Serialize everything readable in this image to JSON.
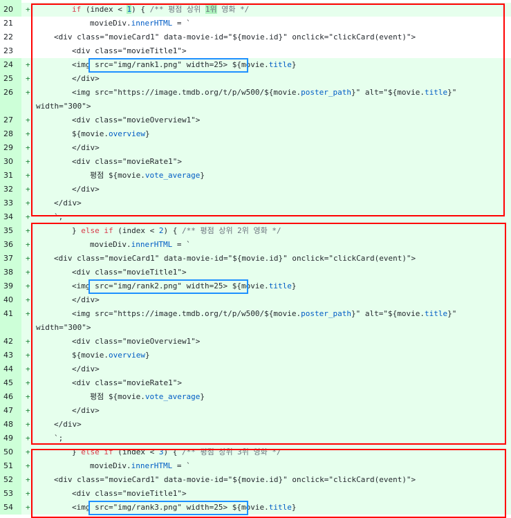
{
  "diff": {
    "lines": [
      {
        "n": "20",
        "k": "add",
        "i": 2,
        "s": [
          [
            "kw",
            "if"
          ],
          [
            "t",
            " (index < "
          ],
          [
            "hl",
            "1"
          ],
          [
            "t",
            ") { "
          ],
          [
            "cm",
            "/** 평점 상위 "
          ],
          [
            "hlcm",
            "1위"
          ],
          [
            "cm",
            " 영화 */"
          ]
        ]
      },
      {
        "n": "21",
        "k": "ctx",
        "i": 3,
        "s": [
          [
            "t",
            "movieDiv."
          ],
          [
            "prop",
            "innerHTML"
          ],
          [
            "t",
            " = `"
          ]
        ]
      },
      {
        "n": "22",
        "k": "ctx",
        "i": 1,
        "s": [
          [
            "t",
            "<div class=\"movieCard1\" data-movie-id=\"${movie.id}\" onclick=\"clickCard(event)\">"
          ]
        ]
      },
      {
        "n": "23",
        "k": "ctx",
        "i": 2,
        "s": [
          [
            "t",
            "<div class=\"movieTitle1\">"
          ]
        ]
      },
      {
        "n": "24",
        "k": "add",
        "i": 2,
        "s": [
          [
            "t",
            "<img src=\"img/rank1.png\" width=25>"
          ],
          [
            "t",
            " ${movie."
          ],
          [
            "prop",
            "title"
          ],
          [
            "t",
            "}"
          ]
        ]
      },
      {
        "n": "25",
        "k": "add",
        "i": 2,
        "s": [
          [
            "t",
            "</div>"
          ]
        ]
      },
      {
        "n": "26",
        "k": "add",
        "i": 2,
        "s": [
          [
            "t",
            "<img src=\"https://image.tmdb.org/t/p/w500/${movie."
          ],
          [
            "prop",
            "poster_path"
          ],
          [
            "t",
            "}\" alt=\"${movie."
          ],
          [
            "prop",
            "title"
          ],
          [
            "t",
            "}\""
          ]
        ]
      },
      {
        "n": "",
        "k": "add",
        "i": -1,
        "s": [
          [
            "t",
            "width=\"300\">"
          ]
        ]
      },
      {
        "n": "27",
        "k": "add",
        "i": 2,
        "s": [
          [
            "t",
            "<div class=\"movieOverview1\">"
          ]
        ]
      },
      {
        "n": "28",
        "k": "add",
        "i": 2,
        "s": [
          [
            "t",
            "${movie."
          ],
          [
            "prop",
            "overview"
          ],
          [
            "t",
            "}"
          ]
        ]
      },
      {
        "n": "29",
        "k": "add",
        "i": 2,
        "s": [
          [
            "t",
            "</div>"
          ]
        ]
      },
      {
        "n": "30",
        "k": "add",
        "i": 2,
        "s": [
          [
            "t",
            "<div class=\"movieRate1\">"
          ]
        ]
      },
      {
        "n": "31",
        "k": "add",
        "i": 3,
        "s": [
          [
            "t",
            "평점 ${movie."
          ],
          [
            "prop",
            "vote_average"
          ],
          [
            "t",
            "}"
          ]
        ]
      },
      {
        "n": "32",
        "k": "add",
        "i": 2,
        "s": [
          [
            "t",
            "</div>"
          ]
        ]
      },
      {
        "n": "33",
        "k": "add",
        "i": 1,
        "s": [
          [
            "t",
            "</div>"
          ]
        ]
      },
      {
        "n": "34",
        "k": "add",
        "i": 1,
        "s": [
          [
            "t",
            "`;"
          ]
        ]
      },
      {
        "n": "35",
        "k": "add",
        "i": 2,
        "s": [
          [
            "t",
            "} "
          ],
          [
            "kw",
            "else if"
          ],
          [
            "t",
            " (index < "
          ],
          [
            "num-lit",
            "2"
          ],
          [
            "t",
            ") { "
          ],
          [
            "cm",
            "/** 평점 상위 2위 영화 */"
          ]
        ]
      },
      {
        "n": "36",
        "k": "add",
        "i": 3,
        "s": [
          [
            "t",
            "movieDiv."
          ],
          [
            "prop",
            "innerHTML"
          ],
          [
            "t",
            " = `"
          ]
        ]
      },
      {
        "n": "37",
        "k": "add",
        "i": 1,
        "s": [
          [
            "t",
            "<div class=\"movieCard1\" data-movie-id=\"${movie.id}\" onclick=\"clickCard(event)\">"
          ]
        ]
      },
      {
        "n": "38",
        "k": "add",
        "i": 2,
        "s": [
          [
            "t",
            "<div class=\"movieTitle1\">"
          ]
        ]
      },
      {
        "n": "39",
        "k": "add",
        "i": 2,
        "s": [
          [
            "t",
            "<img src=\"img/rank2.png\" width=25>"
          ],
          [
            "t",
            " ${movie."
          ],
          [
            "prop",
            "title"
          ],
          [
            "t",
            "}"
          ]
        ]
      },
      {
        "n": "40",
        "k": "add",
        "i": 2,
        "s": [
          [
            "t",
            "</div>"
          ]
        ]
      },
      {
        "n": "41",
        "k": "add",
        "i": 2,
        "s": [
          [
            "t",
            "<img src=\"https://image.tmdb.org/t/p/w500/${movie."
          ],
          [
            "prop",
            "poster_path"
          ],
          [
            "t",
            "}\" alt=\"${movie."
          ],
          [
            "prop",
            "title"
          ],
          [
            "t",
            "}\""
          ]
        ]
      },
      {
        "n": "",
        "k": "add",
        "i": -1,
        "s": [
          [
            "t",
            "width=\"300\">"
          ]
        ]
      },
      {
        "n": "42",
        "k": "add",
        "i": 2,
        "s": [
          [
            "t",
            "<div class=\"movieOverview1\">"
          ]
        ]
      },
      {
        "n": "43",
        "k": "add",
        "i": 2,
        "s": [
          [
            "t",
            "${movie."
          ],
          [
            "prop",
            "overview"
          ],
          [
            "t",
            "}"
          ]
        ]
      },
      {
        "n": "44",
        "k": "add",
        "i": 2,
        "s": [
          [
            "t",
            "</div>"
          ]
        ]
      },
      {
        "n": "45",
        "k": "add",
        "i": 2,
        "s": [
          [
            "t",
            "<div class=\"movieRate1\">"
          ]
        ]
      },
      {
        "n": "46",
        "k": "add",
        "i": 3,
        "s": [
          [
            "t",
            "평점 ${movie."
          ],
          [
            "prop",
            "vote_average"
          ],
          [
            "t",
            "}"
          ]
        ]
      },
      {
        "n": "47",
        "k": "add",
        "i": 2,
        "s": [
          [
            "t",
            "</div>"
          ]
        ]
      },
      {
        "n": "48",
        "k": "add",
        "i": 1,
        "s": [
          [
            "t",
            "</div>"
          ]
        ]
      },
      {
        "n": "49",
        "k": "add",
        "i": 1,
        "s": [
          [
            "t",
            "`;"
          ]
        ]
      },
      {
        "n": "50",
        "k": "add",
        "i": 2,
        "s": [
          [
            "t",
            "} "
          ],
          [
            "kw",
            "else if"
          ],
          [
            "t",
            " (index < "
          ],
          [
            "num-lit",
            "3"
          ],
          [
            "t",
            ") { "
          ],
          [
            "cm",
            "/** 평점 상위 3위 영화 */"
          ]
        ]
      },
      {
        "n": "51",
        "k": "add",
        "i": 3,
        "s": [
          [
            "t",
            "movieDiv."
          ],
          [
            "prop",
            "innerHTML"
          ],
          [
            "t",
            " = `"
          ]
        ]
      },
      {
        "n": "52",
        "k": "add",
        "i": 1,
        "s": [
          [
            "t",
            "<div class=\"movieCard1\" data-movie-id=\"${movie.id}\" onclick=\"clickCard(event)\">"
          ]
        ]
      },
      {
        "n": "53",
        "k": "add",
        "i": 2,
        "s": [
          [
            "t",
            "<div class=\"movieTitle1\">"
          ]
        ]
      },
      {
        "n": "54",
        "k": "add",
        "i": 2,
        "s": [
          [
            "t",
            "<img src=\"img/rank3.png\" width=25>"
          ],
          [
            "t",
            " ${movie."
          ],
          [
            "prop",
            "title"
          ],
          [
            "t",
            "}"
          ]
        ]
      }
    ],
    "plus_marker": "+",
    "colors": {
      "added_bg": "#e6ffed",
      "added_gutter": "#cdffd8",
      "red_box": "#ff0000",
      "blue_box": "#1e90ff"
    }
  }
}
